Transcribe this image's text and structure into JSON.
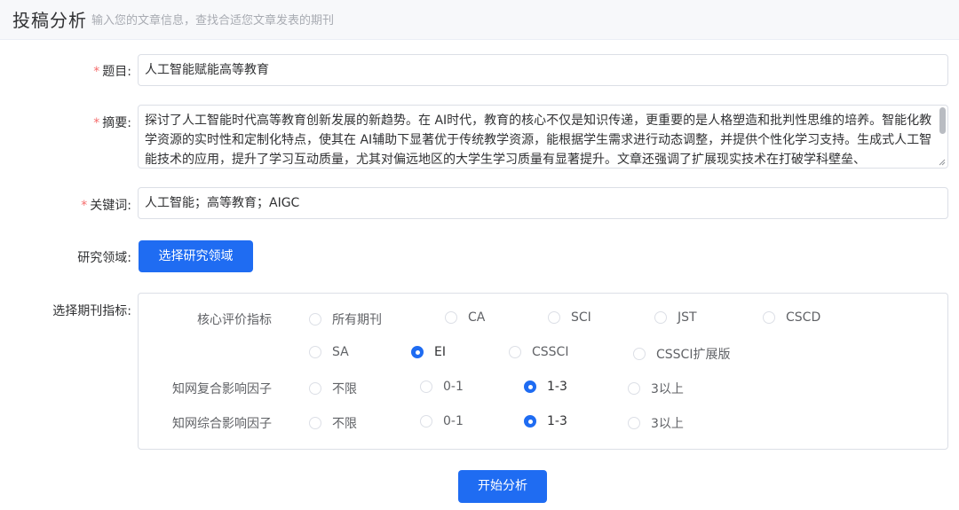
{
  "header": {
    "title": "投稿分析",
    "subtitle": "输入您的文章信息，查找合适您文章发表的期刊"
  },
  "form": {
    "required_mark": "*",
    "title_label": "题目:",
    "title_value": "人工智能赋能高等教育",
    "abstract_label": "摘要:",
    "abstract_value": "探讨了人工智能时代高等教育创新发展的新趋势。在 AI时代，教育的核心不仅是知识传递，更重要的是人格塑造和批判性思维的培养。智能化教学资源的实时性和定制化特点，使其在 AI辅助下显著优于传统教学资源，能根据学生需求进行动态调整，并提供个性化学习支持。生成式人工智能技术的应用，提升了学习互动质量，尤其对偏远地区的大学生学习质量有显著提升。文章还强调了扩展现实技术在打破学科壁垒、",
    "keywords_label": "关键词:",
    "keywords_value": "人工智能；高等教育；AIGC",
    "field_label": "研究领域:",
    "field_button": "选择研究领域",
    "indicator_label": "选择期刊指标:",
    "submit_button": "开始分析"
  },
  "indicators": {
    "core_label": "核心评价指标",
    "core_options_row1": [
      {
        "label": "所有期刊",
        "checked": false
      },
      {
        "label": "CA",
        "checked": false
      },
      {
        "label": "SCI",
        "checked": false
      },
      {
        "label": "JST",
        "checked": false
      },
      {
        "label": "CSCD",
        "checked": false
      }
    ],
    "core_options_row2": [
      {
        "label": "SA",
        "checked": false
      },
      {
        "label": "EI",
        "checked": true
      },
      {
        "label": "CSSCI",
        "checked": false
      },
      {
        "label": "CSSCI扩展版",
        "checked": false
      }
    ],
    "composite_label": "知网复合影响因子",
    "composite_options": [
      {
        "label": "不限",
        "checked": false
      },
      {
        "label": "0-1",
        "checked": false
      },
      {
        "label": "1-3",
        "checked": true
      },
      {
        "label": "3以上",
        "checked": false
      }
    ],
    "comprehensive_label": "知网综合影响因子",
    "comprehensive_options": [
      {
        "label": "不限",
        "checked": false
      },
      {
        "label": "0-1",
        "checked": false
      },
      {
        "label": "1-3",
        "checked": true
      },
      {
        "label": "3以上",
        "checked": false
      }
    ]
  }
}
